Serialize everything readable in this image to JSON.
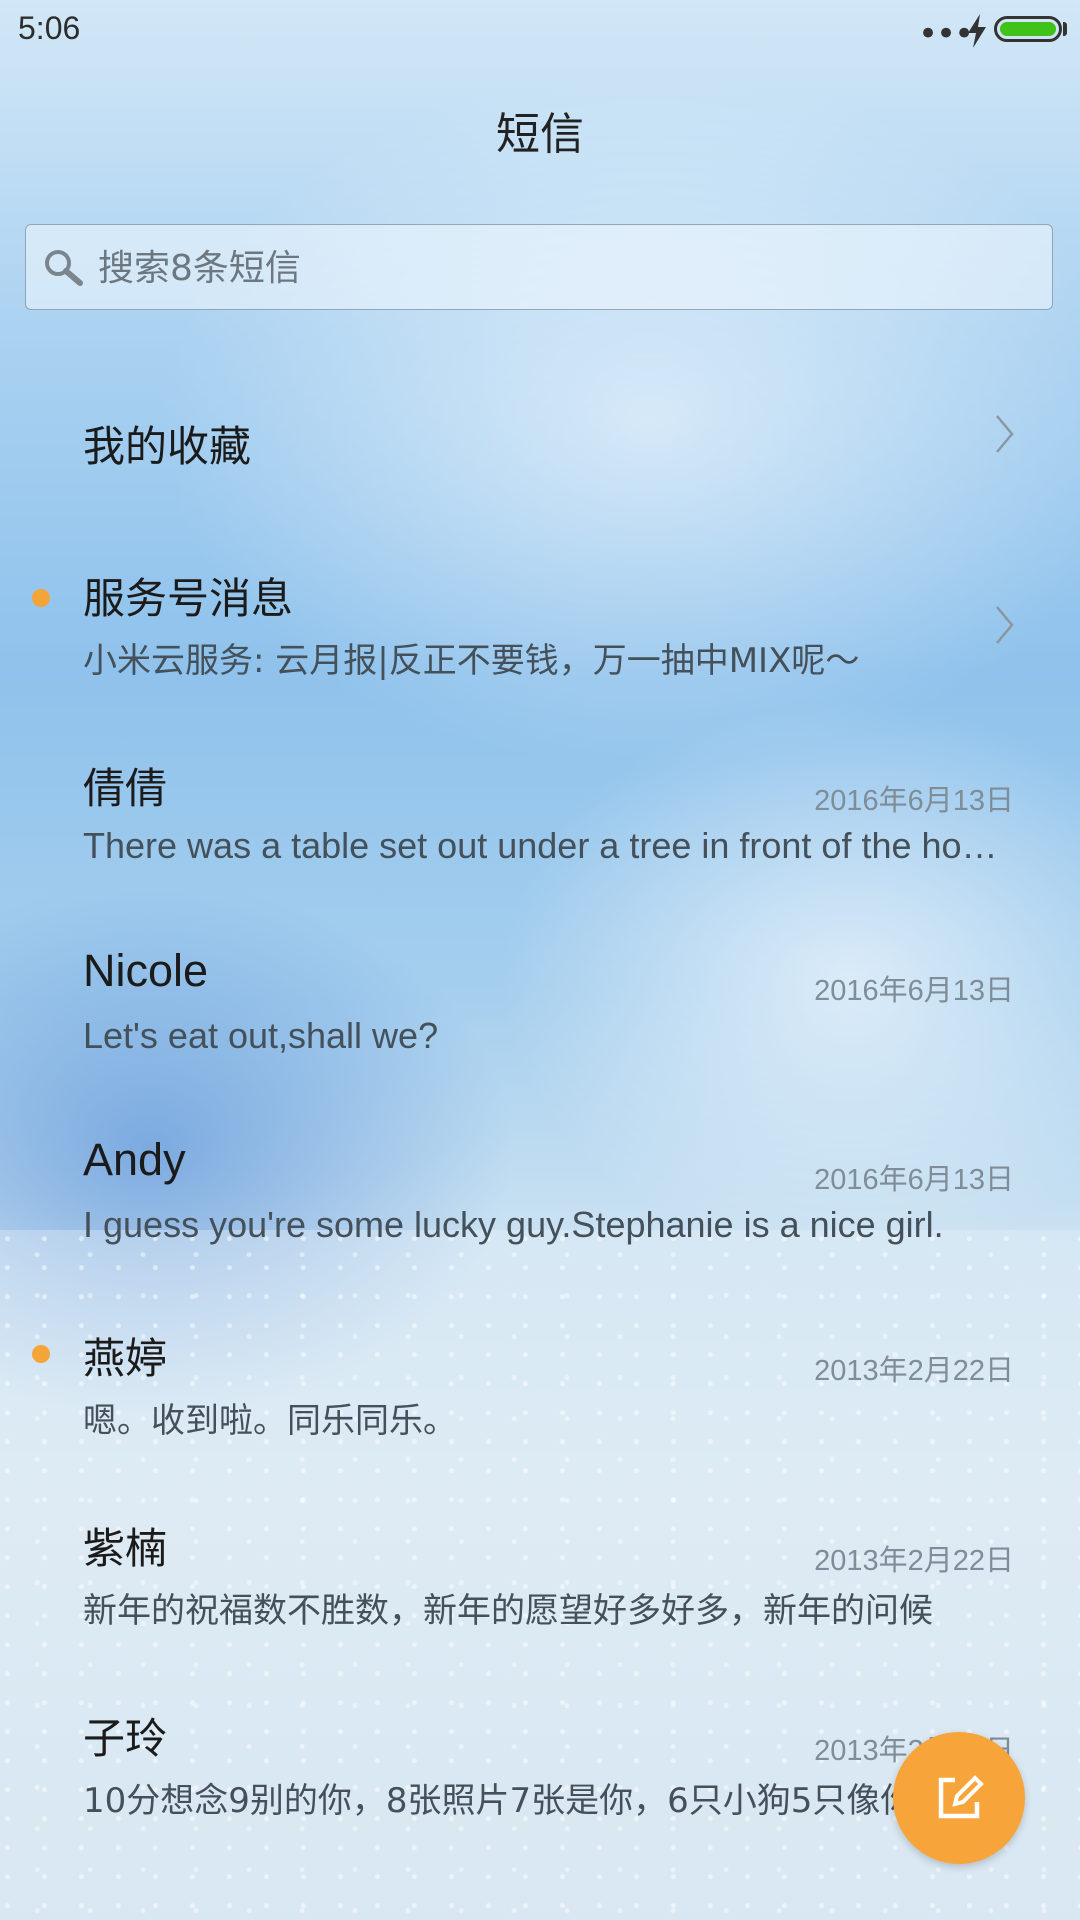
{
  "status_bar": {
    "time": "5:06",
    "more_dots": "•••"
  },
  "title": "短信",
  "search": {
    "placeholder": "搜索8条短信"
  },
  "favorites": {
    "label": "我的收藏"
  },
  "service": {
    "title": "服务号消息",
    "preview": "小米云服务: 云月报|反正不要钱，万一抽中MIX呢～",
    "unread": true
  },
  "conversations": [
    {
      "name": "倩倩",
      "date": "2016年6月13日",
      "preview": "There was a table set out under a tree in front of the house",
      "unread": false
    },
    {
      "name": "Nicole",
      "date": "2016年6月13日",
      "preview": "Let's eat out,shall we?",
      "unread": false
    },
    {
      "name": "Andy",
      "date": "2016年6月13日",
      "preview": "I guess you're some lucky guy.Stephanie is a nice girl.",
      "unread": false
    },
    {
      "name": "燕婷",
      "date": "2013年2月22日",
      "preview": "嗯。收到啦。同乐同乐。",
      "unread": true
    },
    {
      "name": "紫楠",
      "date": "2013年2月22日",
      "preview": "新年的祝福数不胜数，新年的愿望好多好多，新年的问候",
      "unread": false
    },
    {
      "name": "子玲",
      "date": "2013年2月22日",
      "preview": "10分想念9别的你，8张照片7张是你，6只小狗5只像你",
      "unread": false
    }
  ],
  "colors": {
    "accent": "#f7a53a",
    "unread_dot": "#f5a438",
    "battery": "#3fc21a"
  },
  "icons": {
    "compose": "compose-icon",
    "search": "search-icon",
    "chevron": "chevron-right-icon"
  }
}
